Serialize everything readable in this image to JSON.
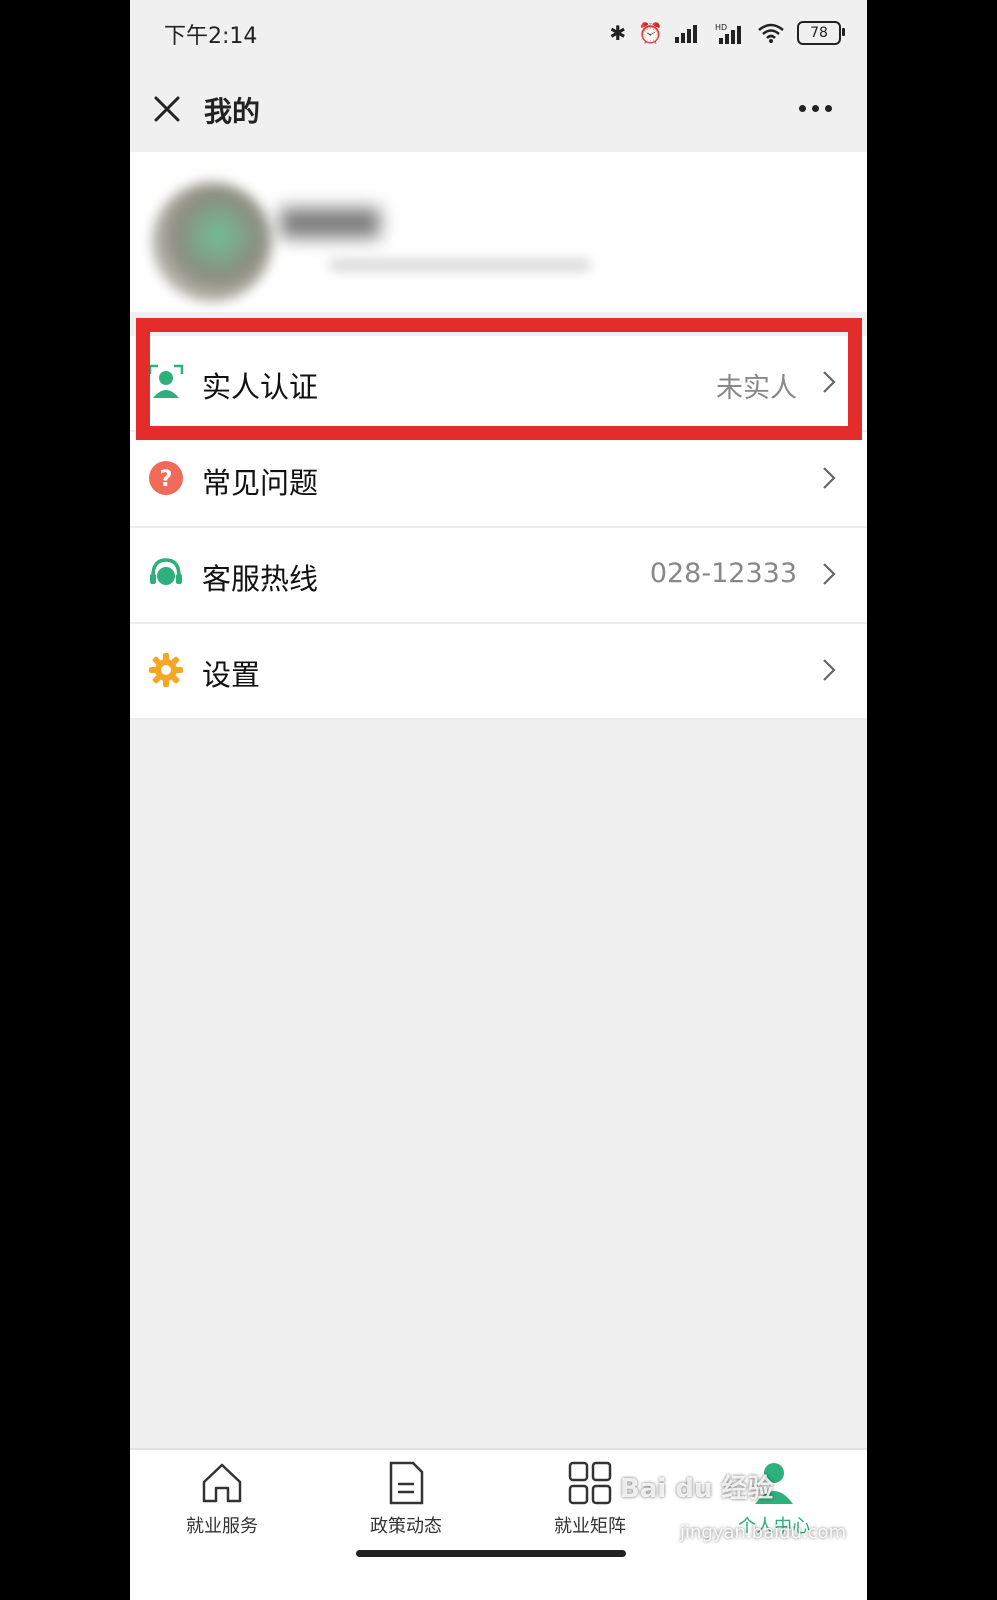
{
  "status_bar": {
    "time": "下午2:14",
    "battery": "78",
    "signal_hd": "HD"
  },
  "nav": {
    "title": "我的",
    "close_icon": "close-icon",
    "more_icon": "more-icon"
  },
  "menu": [
    {
      "label": "实人认证",
      "value": "未实人",
      "icon": "face-verify-icon"
    },
    {
      "label": "常见问题",
      "value": "",
      "icon": "question-icon"
    },
    {
      "label": "客服热线",
      "value": "028-12333",
      "icon": "headset-icon"
    },
    {
      "label": "设置",
      "value": "",
      "icon": "gear-icon"
    }
  ],
  "tabs": [
    {
      "label": "就业服务",
      "icon": "home-icon"
    },
    {
      "label": "政策动态",
      "icon": "document-icon"
    },
    {
      "label": "就业矩阵",
      "icon": "grid-icon"
    },
    {
      "label": "个人中心",
      "icon": "person-icon",
      "active": true
    }
  ],
  "watermark": {
    "brand": "Bai du 经验",
    "url": "jingyan.baidu.com"
  },
  "colors": {
    "accent": "#2db07b",
    "highlight": "#e42c2a",
    "question": "#f06a5a",
    "gear": "#f5a623"
  }
}
